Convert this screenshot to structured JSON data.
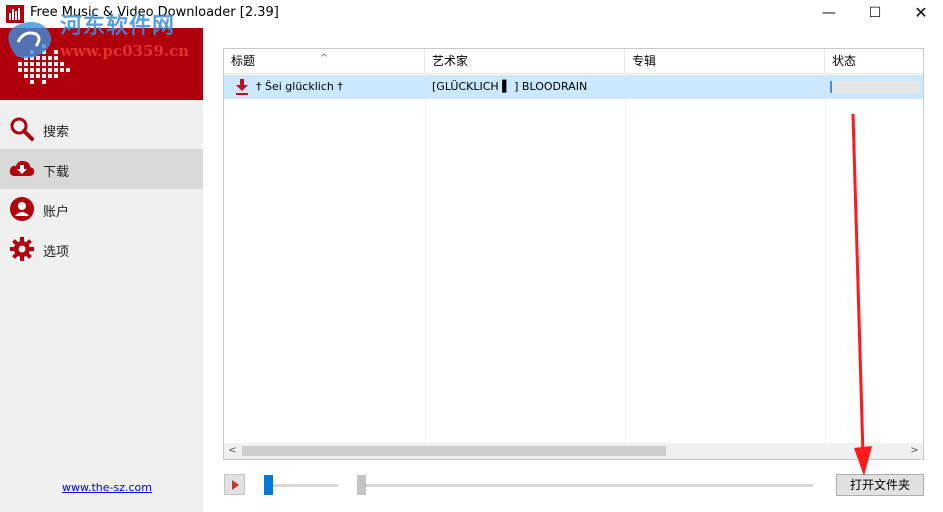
{
  "window": {
    "title": "Free Music & Video Downloader [2.39]",
    "minimize": "—",
    "maximize": "☐",
    "close": "✕"
  },
  "watermark": {
    "title": "河东软件网",
    "url": "www.pc0359.cn"
  },
  "sidebar": {
    "items": [
      {
        "label": "搜索",
        "icon": "search-icon"
      },
      {
        "label": "下载",
        "icon": "cloud-download-icon",
        "active": true
      },
      {
        "label": "账户",
        "icon": "user-icon"
      },
      {
        "label": "选项",
        "icon": "gear-icon"
      }
    ],
    "link": "www.the-sz.com"
  },
  "table": {
    "columns": [
      "标题",
      "艺术家",
      "专辑",
      "状态"
    ],
    "rows": [
      {
        "title": "† Šei glücklich †",
        "artist": "[GLÜCKLICH ▌ ] BLOODRAIN",
        "album": "",
        "status_progress": 0.02
      }
    ],
    "scroll_left": "<",
    "scroll_right": ">"
  },
  "controls": {
    "open_folder": "打开文件夹"
  },
  "colors": {
    "brand_red": "#b0000b",
    "accent_blue": "#0078d7",
    "row_selected": "#cce8ff"
  }
}
